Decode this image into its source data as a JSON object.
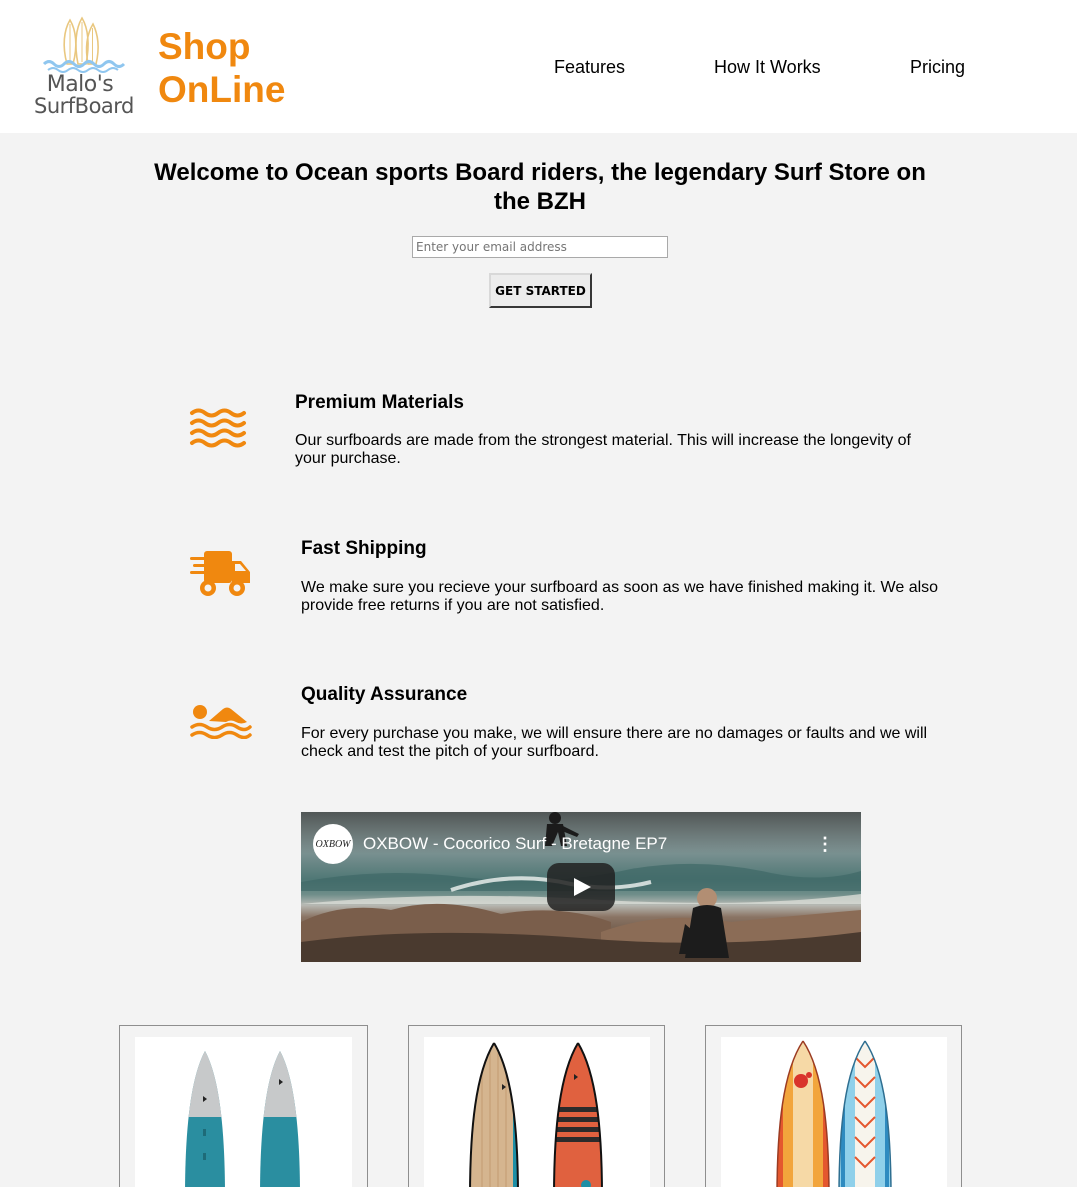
{
  "header": {
    "logo": {
      "line1": "Malo's",
      "line2": "SurfBoard"
    },
    "brand": {
      "line1": "Shop",
      "line2": "OnLine"
    },
    "nav": [
      {
        "label": "Features"
      },
      {
        "label": "How It Works"
      },
      {
        "label": "Pricing"
      }
    ]
  },
  "hero": {
    "title": "Welcome to Ocean sports Board riders, the legendary Surf Store on the BZH",
    "email_placeholder": "Enter your email address",
    "button_label": "GET STARTED"
  },
  "features": [
    {
      "icon": "water-waves-icon",
      "title": "Premium Materials",
      "text": "Our surfboards are made from the strongest material. This will increase the longevity of your purchase."
    },
    {
      "icon": "shipping-truck-icon",
      "title": "Fast Shipping",
      "text": "We make sure you recieve your surfboard as soon as we have finished making it. We also provide free returns if you are not satisfied."
    },
    {
      "icon": "swimmer-icon",
      "title": "Quality Assurance",
      "text": "For every purchase you make, we will ensure there are no damages or faults and we will check and test the pitch of your surfboard."
    }
  ],
  "video": {
    "channel": "OXBOW",
    "title": "OXBOW - Cocorico Surf - Bretagne EP7"
  },
  "colors": {
    "accent": "#f0880f",
    "header_bg": "#ffffff",
    "page_bg": "#f3f3f3"
  }
}
